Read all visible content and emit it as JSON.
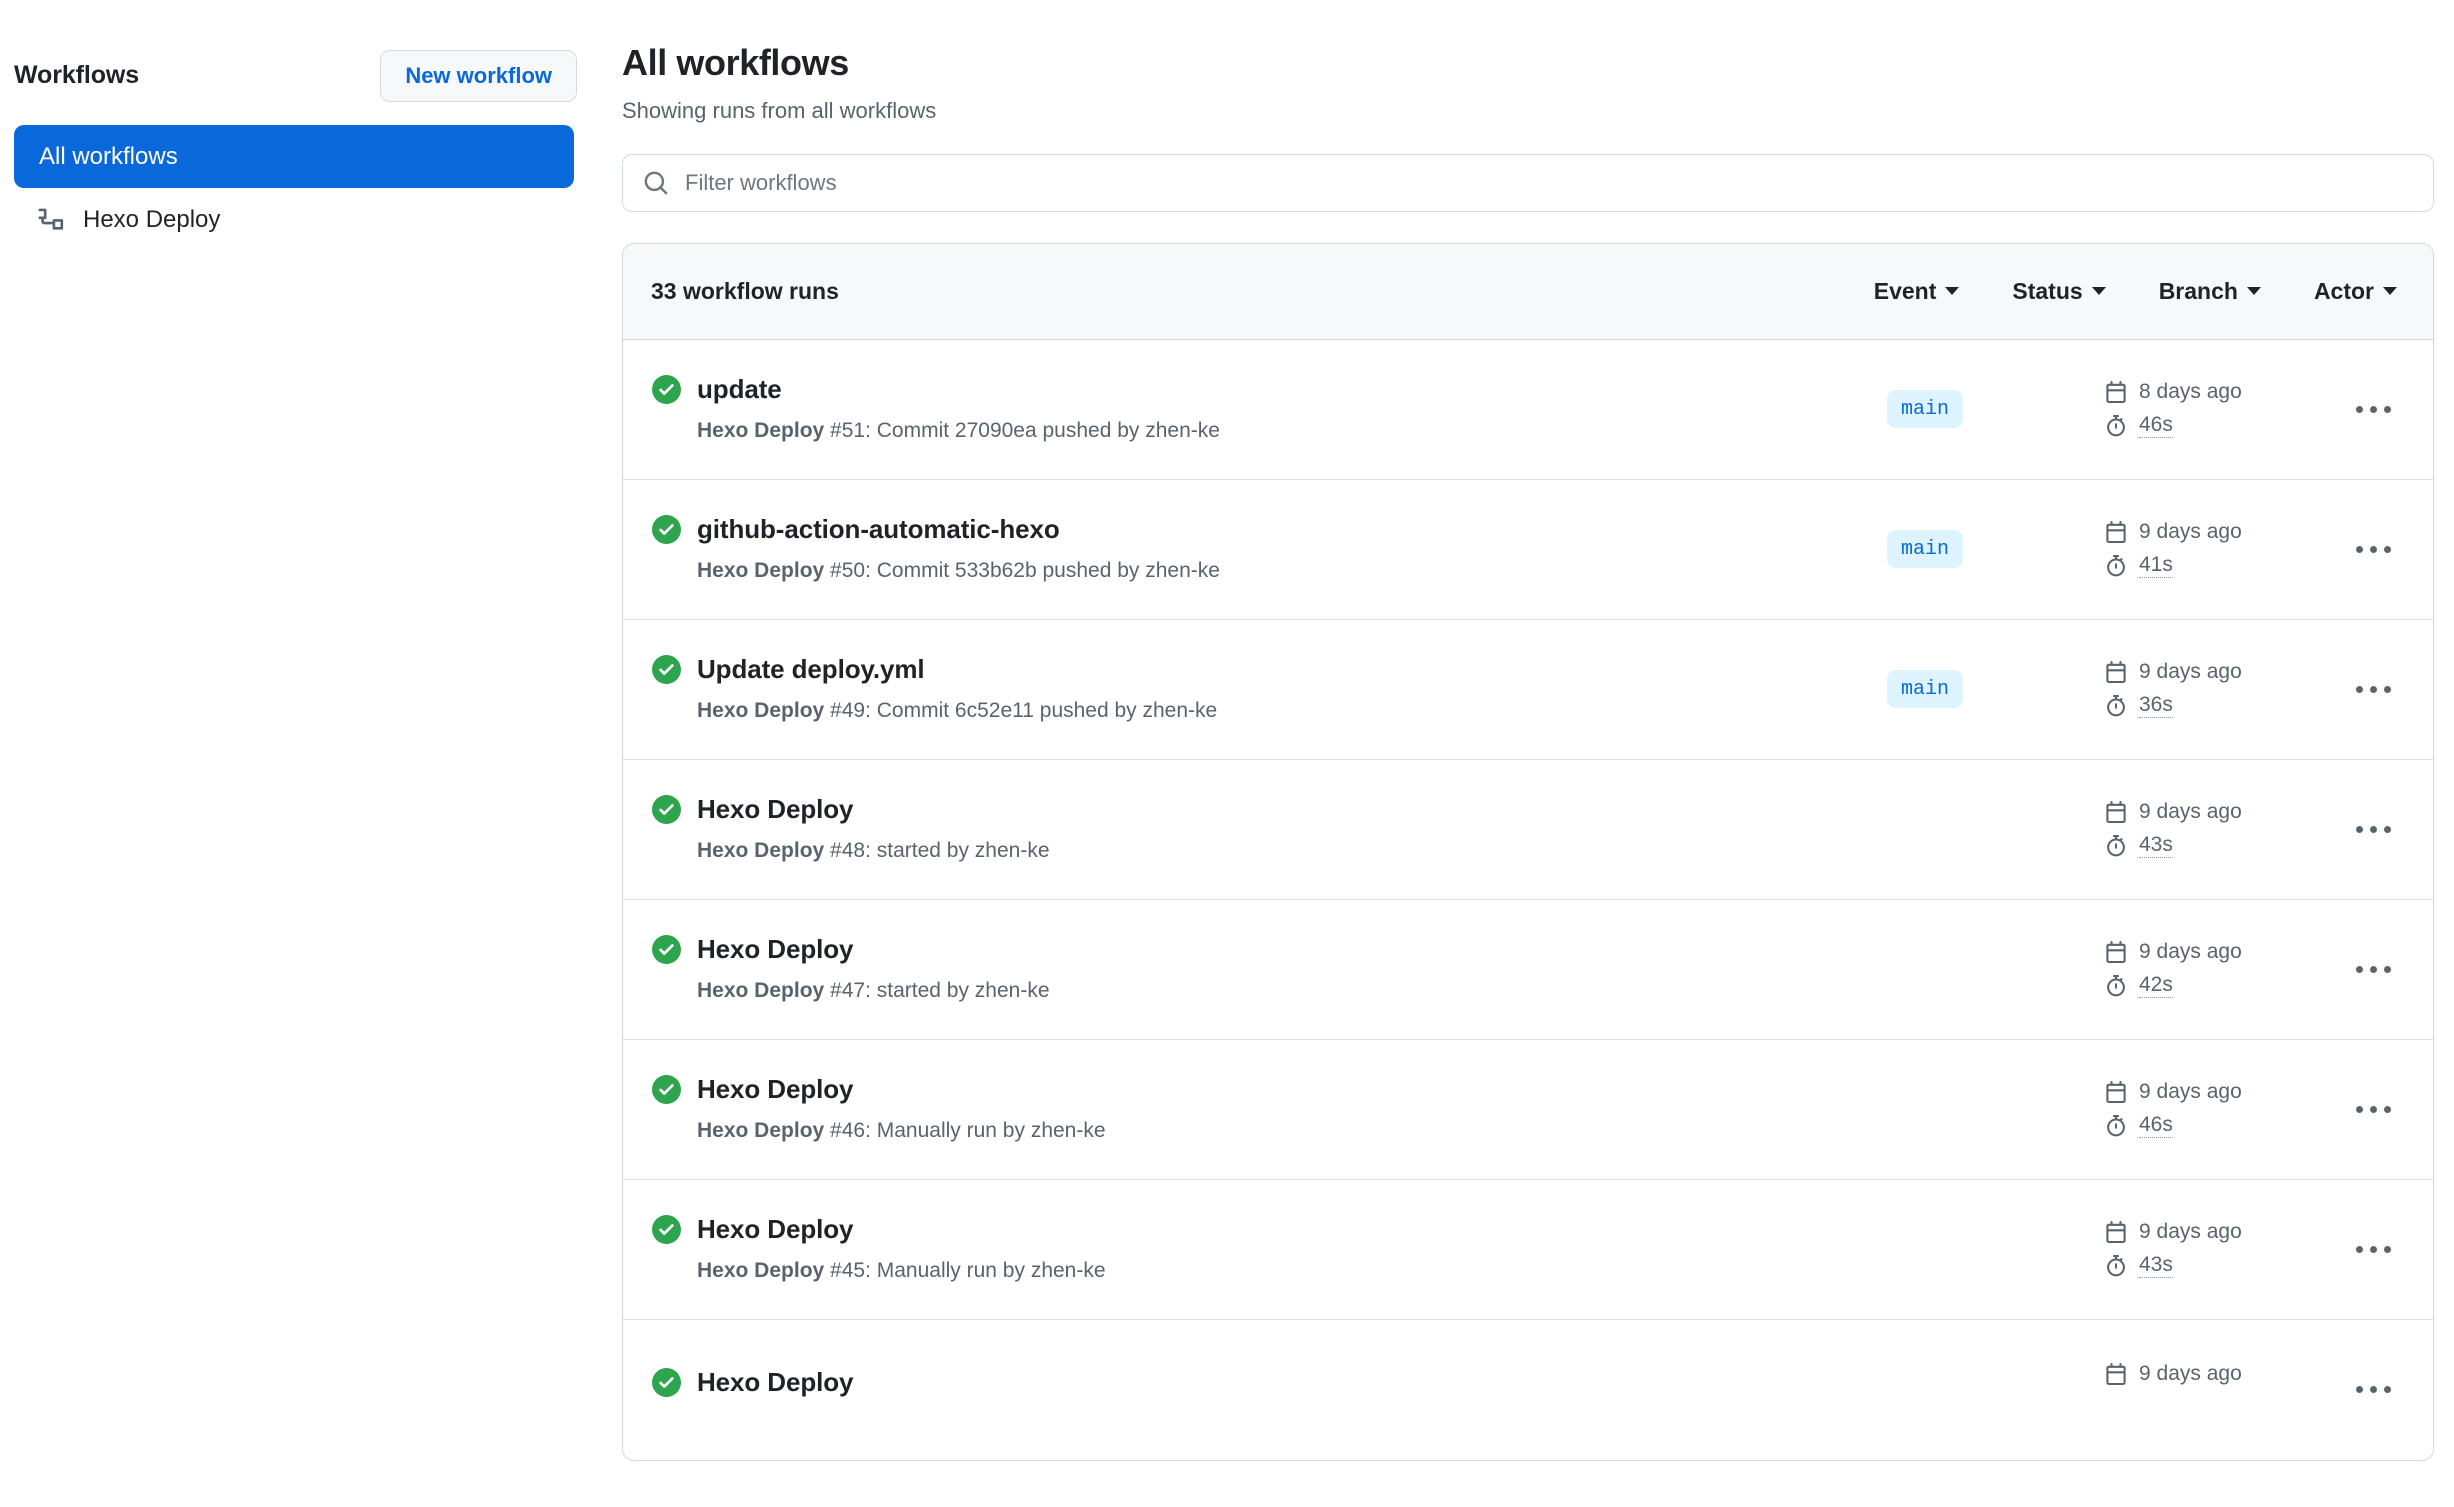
{
  "sidebar": {
    "title": "Workflows",
    "new_workflow_label": "New workflow",
    "items": [
      {
        "label": "All workflows",
        "icon": "none",
        "selected": true
      },
      {
        "label": "Hexo Deploy",
        "icon": "workflow-icon",
        "selected": false
      }
    ]
  },
  "main": {
    "page_title": "All workflows",
    "subtitle": "Showing runs from all workflows",
    "filter": {
      "placeholder": "Filter workflows",
      "value": "",
      "icon": "search-icon"
    },
    "runs_header": {
      "count_label": "33 workflow runs",
      "filters": [
        {
          "label": "Event",
          "icon": "chevron-down-icon"
        },
        {
          "label": "Status",
          "icon": "chevron-down-icon"
        },
        {
          "label": "Branch",
          "icon": "chevron-down-icon"
        },
        {
          "label": "Actor",
          "icon": "chevron-down-icon"
        }
      ]
    },
    "runs": [
      {
        "status": "success",
        "status_icon": "check-circle-fill-icon",
        "title": "update",
        "workflow_name": "Hexo Deploy",
        "detail": " #51: Commit 27090ea pushed by zhen-ke",
        "branch": "main",
        "date": "8 days ago",
        "duration": "46s",
        "menu_icon": "kebab-horizontal-icon"
      },
      {
        "status": "success",
        "status_icon": "check-circle-fill-icon",
        "title": "github-action-automatic-hexo",
        "workflow_name": "Hexo Deploy",
        "detail": " #50: Commit 533b62b pushed by zhen-ke",
        "branch": "main",
        "date": "9 days ago",
        "duration": "41s",
        "menu_icon": "kebab-horizontal-icon"
      },
      {
        "status": "success",
        "status_icon": "check-circle-fill-icon",
        "title": "Update deploy.yml",
        "workflow_name": "Hexo Deploy",
        "detail": " #49: Commit 6c52e11 pushed by zhen-ke",
        "branch": "main",
        "date": "9 days ago",
        "duration": "36s",
        "menu_icon": "kebab-horizontal-icon"
      },
      {
        "status": "success",
        "status_icon": "check-circle-fill-icon",
        "title": "Hexo Deploy",
        "workflow_name": "Hexo Deploy",
        "detail": " #48: started by zhen-ke",
        "branch": "",
        "date": "9 days ago",
        "duration": "43s",
        "menu_icon": "kebab-horizontal-icon"
      },
      {
        "status": "success",
        "status_icon": "check-circle-fill-icon",
        "title": "Hexo Deploy",
        "workflow_name": "Hexo Deploy",
        "detail": " #47: started by zhen-ke",
        "branch": "",
        "date": "9 days ago",
        "duration": "42s",
        "menu_icon": "kebab-horizontal-icon"
      },
      {
        "status": "success",
        "status_icon": "check-circle-fill-icon",
        "title": "Hexo Deploy",
        "workflow_name": "Hexo Deploy",
        "detail": " #46: Manually run by zhen-ke",
        "branch": "",
        "date": "9 days ago",
        "duration": "46s",
        "menu_icon": "kebab-horizontal-icon"
      },
      {
        "status": "success",
        "status_icon": "check-circle-fill-icon",
        "title": "Hexo Deploy",
        "workflow_name": "Hexo Deploy",
        "detail": " #45: Manually run by zhen-ke",
        "branch": "",
        "date": "9 days ago",
        "duration": "43s",
        "menu_icon": "kebab-horizontal-icon"
      },
      {
        "status": "success",
        "status_icon": "check-circle-fill-icon",
        "title": "Hexo Deploy",
        "workflow_name": "",
        "detail": "",
        "branch": "",
        "date": "9 days ago",
        "duration": "",
        "menu_icon": "kebab-horizontal-icon"
      }
    ]
  },
  "colors": {
    "accent": "#0969da",
    "success": "#2da44e",
    "badge_bg": "#ddf4ff",
    "border": "#d1d9e0",
    "header_bg": "#f6f8fa",
    "muted_text": "#59636e"
  }
}
